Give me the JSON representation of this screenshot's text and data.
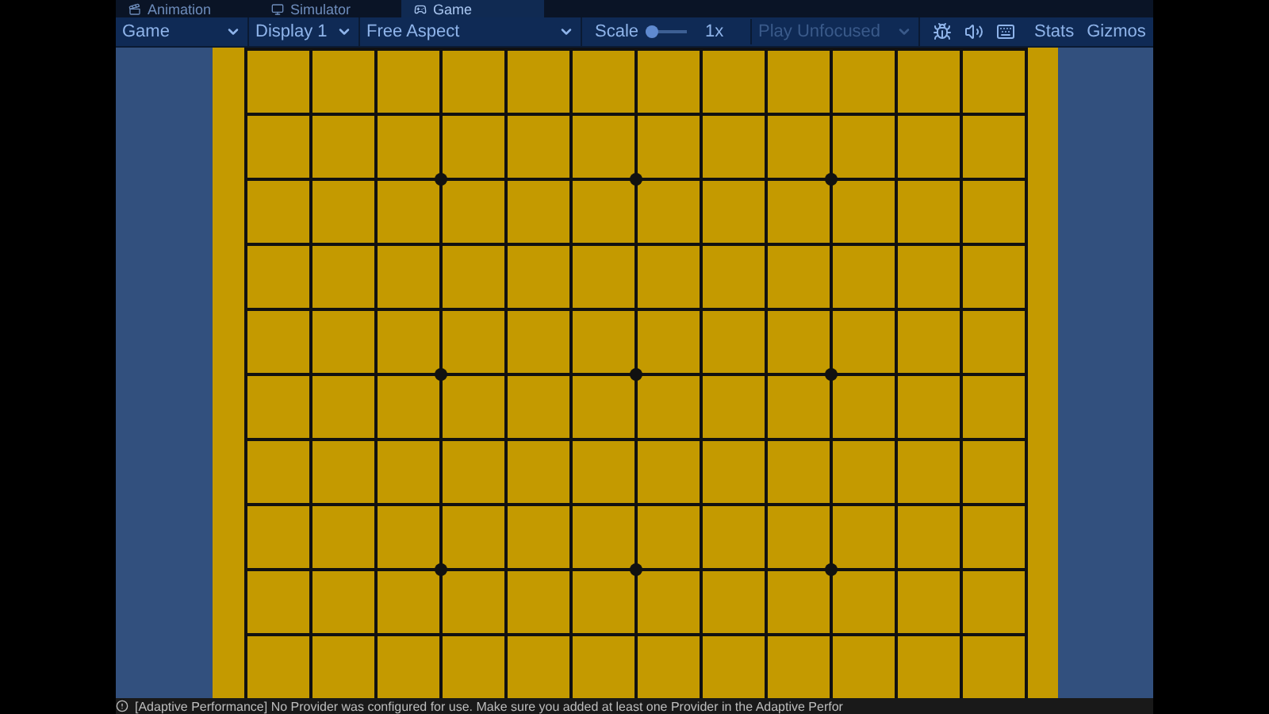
{
  "tabs": [
    {
      "label": "Animation",
      "selected": false
    },
    {
      "label": "Simulator",
      "selected": false
    },
    {
      "label": "Game",
      "selected": true
    }
  ],
  "toolbar": {
    "view_dropdown": "Game",
    "display_dropdown": "Display 1",
    "aspect_dropdown": "Free Aspect",
    "scale_label": "Scale",
    "scale_slider": {
      "level": 0
    },
    "scale_value": "1x",
    "play_mode_dropdown": {
      "label": "Play Unfocused",
      "disabled": true
    },
    "stats": "Stats",
    "gizmos": "Gizmos"
  },
  "status_bar": {
    "message": "[Adaptive Performance] No Provider was configured for use. Make sure you added at least one Provider in the Adaptive Perfor"
  }
}
